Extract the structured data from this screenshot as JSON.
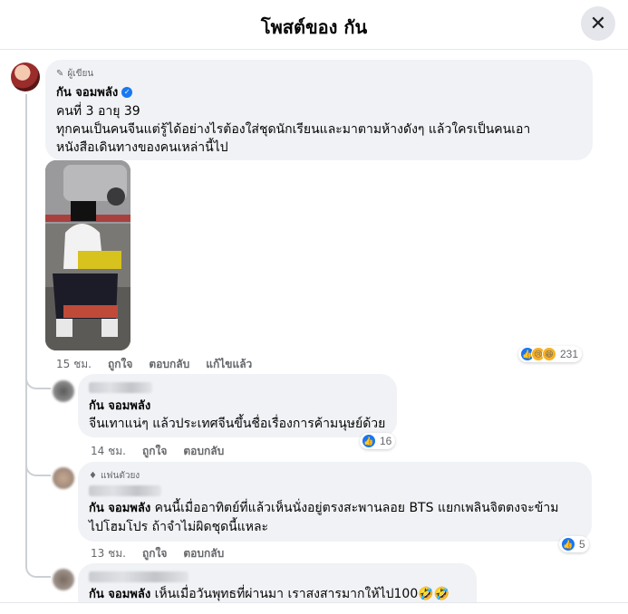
{
  "header": {
    "title": "โพสต์ของ กัน",
    "close_icon": "close-icon"
  },
  "main_comment": {
    "badge": "ผู้เขียน",
    "author": "กัน จอมพลัง",
    "verified": true,
    "text_line1": "คนที่ 3 อายุ 39",
    "text_line2": "ทุกคนเป็นคนจีนแต่รู้ได้อย่างไรต้องใส่ชุดนักเรียนและมาตามห้างดังๆ แล้วใครเป็นคนเอา",
    "text_line3": "หนังสือเดินทางของคนเหล่านี้ไป",
    "time": "15 ชม.",
    "like_label": "ถูกใจ",
    "reply_label": "ตอบกลับ",
    "edited_label": "แก้ไขแล้ว",
    "reaction_count": "231",
    "reaction_icons": [
      "like-icon",
      "sad-icon",
      "haha-icon"
    ]
  },
  "replies": [
    {
      "author": "กัน จอมพลัง",
      "text": "จีนเทาแน่ๆ แล้วประเทศจีนขึ้นชื่อเรื่องการค้ามนุษย์ด้วย",
      "time": "14 ชม.",
      "like_label": "ถูกใจ",
      "reply_label": "ตอบกลับ",
      "reaction_count": "16"
    },
    {
      "badge": "แฟนตัวยง",
      "author": "กัน จอมพลัง",
      "text_line1": "คนนี้เมื่ออาทิตย์ที่แล้วเห็นนั่งอยู่ตรงสะพานลอย BTS แยกเพลินจิตตงจะข้าม",
      "text_line2": "ไปโฮมโปร ถ้าจำไม่ผิดชุดนี้แหละ",
      "time": "13 ชม.",
      "like_label": "ถูกใจ",
      "reply_label": "ตอบกลับ",
      "reaction_count": "5"
    },
    {
      "author": "กัน จอมพลัง",
      "text": "เห็นเมื่อวันพุทธที่ผ่านมา เราสงสารมากให้ไป100🤣🤣"
    }
  ]
}
